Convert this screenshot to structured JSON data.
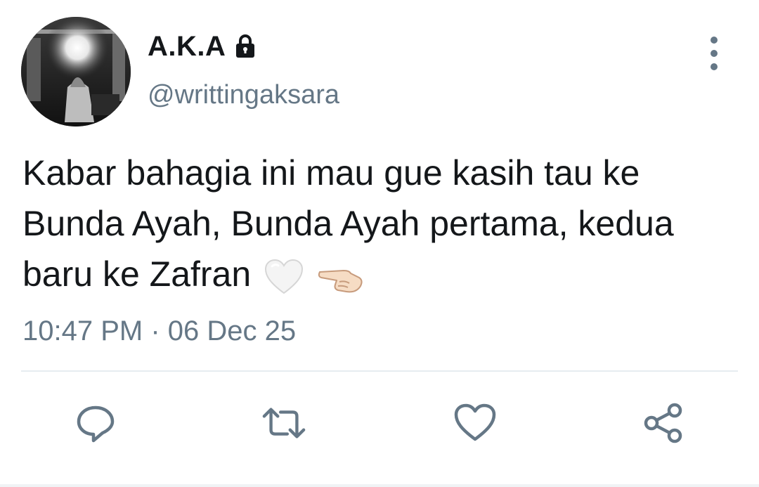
{
  "tweet": {
    "display_name": "A.K.A",
    "handle": "@writtingaksara",
    "text": "Kabar bahagia ini mau gue kasih tau ke Bunda Ayah, Bunda Ayah pertama, kedua baru ke Zafran",
    "emojis": [
      "white-heart-emoji",
      "pointing-hand-emoji"
    ],
    "timestamp": "10:47 PM · 06 Dec 25",
    "protected_account": true
  },
  "icons": {
    "lock": "lock-icon",
    "more": "more-vertical-icon",
    "reply": "reply-icon",
    "retweet": "retweet-icon",
    "like": "heart-icon",
    "share": "share-icon"
  },
  "colors": {
    "text_primary": "#14171a",
    "text_secondary": "#657786",
    "icon": "#657786",
    "divider": "#e6ecf0"
  }
}
